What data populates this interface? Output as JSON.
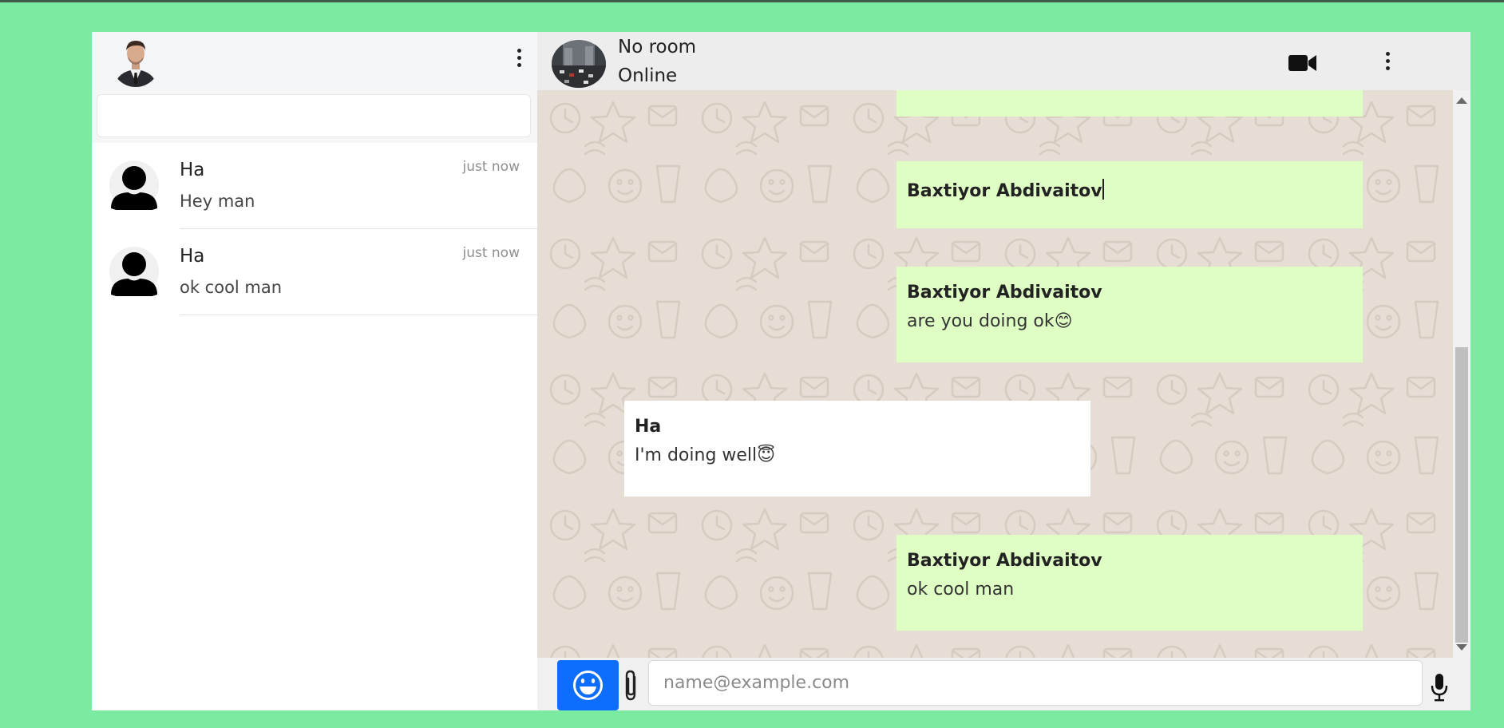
{
  "colors": {
    "page_bg": "#7aeba0",
    "outgoing_bubble": "#dffec4",
    "incoming_bubble": "#ffffff",
    "chat_bg": "#e6ddd4",
    "emoji_button": "#0d6efd"
  },
  "sidebar": {
    "user_avatar_icon": "profile-photo-man-in-suit",
    "menu_icon": "vertical-dots-icon",
    "search": {
      "value": "",
      "placeholder": ""
    },
    "chats": [
      {
        "name": "Ha",
        "time": "just now",
        "preview": "Hey man",
        "avatar_icon": "default-user-silhouette"
      },
      {
        "name": "Ha",
        "time": "just now",
        "preview": "ok cool man",
        "avatar_icon": "default-user-silhouette"
      }
    ]
  },
  "chat": {
    "header": {
      "room_avatar_icon": "city-traffic-photo",
      "room_name": "No room",
      "status": "Online",
      "video_icon": "video-camera-icon",
      "menu_icon": "vertical-dots-icon"
    },
    "messages": [
      {
        "direction": "out",
        "sender": "",
        "text": ""
      },
      {
        "direction": "out",
        "sender": "Baxtiyor Abdivaitov",
        "text": ""
      },
      {
        "direction": "out",
        "sender": "Baxtiyor Abdivaitov",
        "text": "are you doing ok😊"
      },
      {
        "direction": "in",
        "sender": "Ha",
        "text": "I'm doing well😇"
      },
      {
        "direction": "out",
        "sender": "Baxtiyor Abdivaitov",
        "text": "ok cool man"
      }
    ],
    "composer": {
      "emoji_icon": "smiley-icon",
      "attach_icon": "paperclip-icon",
      "input_value": "",
      "input_placeholder": "name@example.com",
      "mic_icon": "microphone-icon"
    }
  }
}
